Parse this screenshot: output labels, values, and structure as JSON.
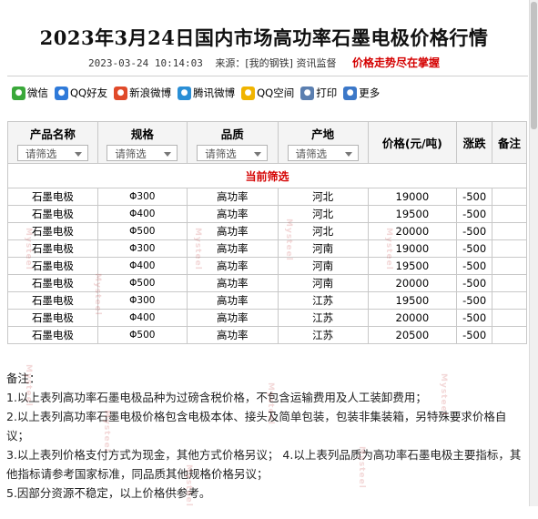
{
  "title": "2023年3月24日国内市场高功率石墨电极价格行情",
  "meta": {
    "datetime": "2023-03-24 10:14:03",
    "source": "来源：[我的钢铁] 资讯监督",
    "highlight": "价格走势尽在掌握"
  },
  "share": [
    {
      "label": "微信",
      "icon": "wechat-icon",
      "color": "#3aa83a"
    },
    {
      "label": "QQ好友",
      "icon": "qq-icon",
      "color": "#2f7ad9"
    },
    {
      "label": "新浪微博",
      "icon": "weibo-icon",
      "color": "#e04a2a"
    },
    {
      "label": "腾讯微博",
      "icon": "tencent-weibo-icon",
      "color": "#2a8fd6"
    },
    {
      "label": "QQ空间",
      "icon": "qzone-icon",
      "color": "#f0b400"
    },
    {
      "label": "打印",
      "icon": "print-icon",
      "color": "#5b7fb0"
    },
    {
      "label": "更多",
      "icon": "more-icon",
      "color": "#3c78c8"
    }
  ],
  "table": {
    "headers": {
      "name": "产品名称",
      "spec": "规格",
      "quality": "品质",
      "origin": "产地",
      "price": "价格(元/吨)",
      "change": "涨跌",
      "remark": "备注"
    },
    "filter_placeholder": "请筛选",
    "current_filter_label": "当前筛选",
    "rows": [
      {
        "name": "石墨电极",
        "spec": "Φ300",
        "quality": "高功率",
        "origin": "河北",
        "price": "19000",
        "change": "-500",
        "remark": ""
      },
      {
        "name": "石墨电极",
        "spec": "Φ400",
        "quality": "高功率",
        "origin": "河北",
        "price": "19500",
        "change": "-500",
        "remark": ""
      },
      {
        "name": "石墨电极",
        "spec": "Φ500",
        "quality": "高功率",
        "origin": "河北",
        "price": "20000",
        "change": "-500",
        "remark": ""
      },
      {
        "name": "石墨电极",
        "spec": "Φ300",
        "quality": "高功率",
        "origin": "河南",
        "price": "19000",
        "change": "-500",
        "remark": ""
      },
      {
        "name": "石墨电极",
        "spec": "Φ400",
        "quality": "高功率",
        "origin": "河南",
        "price": "19500",
        "change": "-500",
        "remark": ""
      },
      {
        "name": "石墨电极",
        "spec": "Φ500",
        "quality": "高功率",
        "origin": "河南",
        "price": "20000",
        "change": "-500",
        "remark": ""
      },
      {
        "name": "石墨电极",
        "spec": "Φ300",
        "quality": "高功率",
        "origin": "江苏",
        "price": "19500",
        "change": "-500",
        "remark": ""
      },
      {
        "name": "石墨电极",
        "spec": "Φ400",
        "quality": "高功率",
        "origin": "江苏",
        "price": "20000",
        "change": "-500",
        "remark": ""
      },
      {
        "name": "石墨电极",
        "spec": "Φ500",
        "quality": "高功率",
        "origin": "江苏",
        "price": "20500",
        "change": "-500",
        "remark": ""
      }
    ]
  },
  "notes": {
    "heading": "备注：",
    "lines": [
      "1.以上表列高功率石墨电极品种为过磅含税价格，不包含运输费用及人工装卸费用；",
      "2.以上表列高功率石墨电极价格包含电极本体、接头及简单包装，包装非集装箱，另特殊要求价格自议；",
      "3.以上表列价格支付方式为现金，其他方式价格另议；  4.以上表列品质为高功率石墨电极主要指标，其他指标请参考国家标准，同品质其他规格价格另议；",
      "5.因部分资源不稳定，以上价格供参考。"
    ]
  },
  "watermark": "Mysteel"
}
